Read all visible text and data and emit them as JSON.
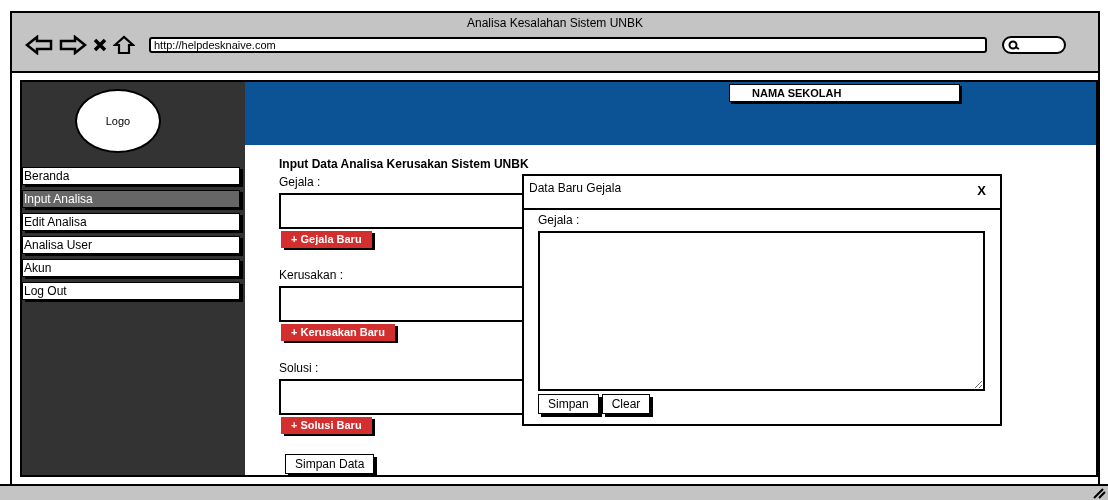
{
  "window": {
    "title": "Analisa Kesalahan Sistem UNBK",
    "url": "http://helpdesknaive.com"
  },
  "sidebar": {
    "logo": "Logo",
    "items": [
      {
        "label": "Beranda",
        "selected": false
      },
      {
        "label": "Input Analisa",
        "selected": true
      },
      {
        "label": "Edit Analisa",
        "selected": false
      },
      {
        "label": "Analisa User",
        "selected": false
      },
      {
        "label": "Akun",
        "selected": false
      },
      {
        "label": "Log Out",
        "selected": false
      }
    ]
  },
  "header": {
    "school": "NAMA SEKOLAH"
  },
  "form": {
    "title": "Input Data Analisa Kerusakan Sistem UNBK",
    "fields": [
      {
        "label": "Gejala :",
        "add_button": "+ Gejala Baru"
      },
      {
        "label": "Kerusakan :",
        "add_button": "+ Kerusakan Baru"
      },
      {
        "label": "Solusi :",
        "add_button": "+ Solusi Baru"
      }
    ],
    "submit": "Simpan Data"
  },
  "dialog": {
    "title": "Data Baru Gejala",
    "close": "X",
    "field_label": "Gejala :",
    "buttons": [
      "Simpan",
      "Clear"
    ]
  }
}
